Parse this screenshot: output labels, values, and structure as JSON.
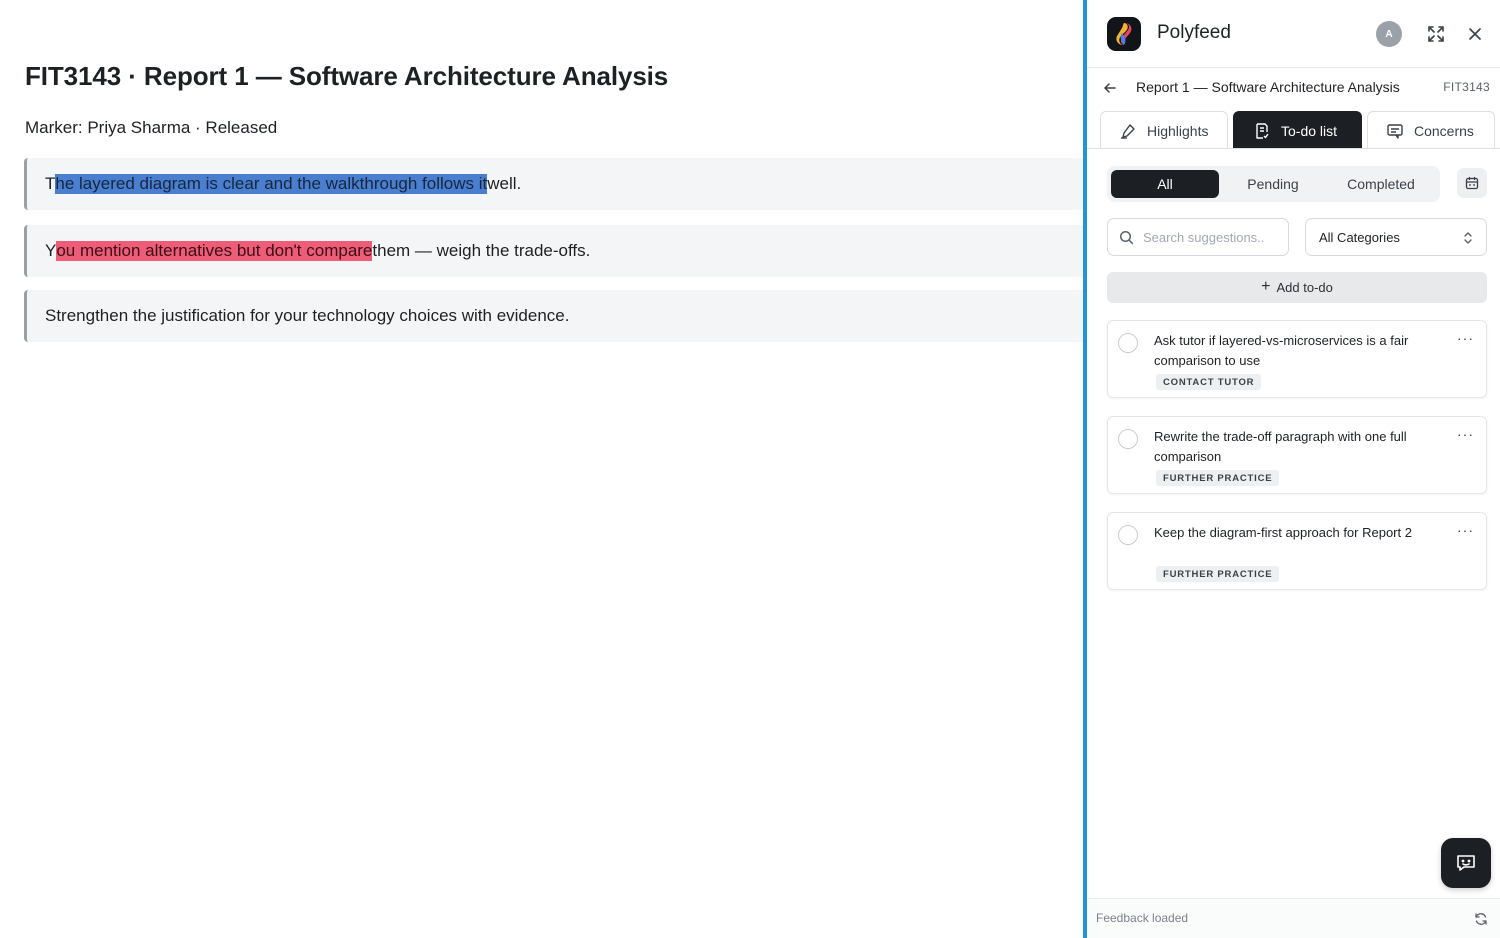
{
  "document": {
    "title": "FIT3143 · Report 1 — Software Architecture Analysis",
    "meta": "Marker: Priya Sharma · Released",
    "feedback": [
      {
        "before": "T",
        "highlight": "he layered diagram is clear and the walkthrough follows it",
        "after": " well.",
        "highlight_color": "#4a7fd0"
      },
      {
        "before": "Y",
        "highlight": "ou mention alternatives but don't compare",
        "after": " them — weigh the trade-offs.",
        "highlight_color": "#ef5c77"
      },
      {
        "text": "Strengthen the justification for your technology choices with evidence."
      }
    ]
  },
  "panel": {
    "brand": "Polyfeed",
    "avatar_initial": "A",
    "accent_color": "#1f94d8",
    "icons": {
      "logo": "polyfeed-logo-icon",
      "expand": "expand-icon",
      "close": "close-icon",
      "back": "back-arrow-icon",
      "highlights": "highlighter-icon",
      "todo": "todo-list-icon",
      "concerns": "concerns-icon",
      "calendar": "calendar-icon",
      "search": "search-icon",
      "select": "chevron-updown-icon",
      "chat": "chat-icon",
      "refresh": "refresh-icon"
    },
    "breadcrumb": {
      "title": "Report 1 — Software Architecture Analysis",
      "code": "FIT3143"
    },
    "tabs": [
      {
        "label": "Highlights",
        "active": false
      },
      {
        "label": "To-do list",
        "active": true
      },
      {
        "label": "Concerns",
        "active": false
      }
    ],
    "filters": [
      {
        "label": "All",
        "active": true
      },
      {
        "label": "Pending",
        "active": false
      },
      {
        "label": "Completed",
        "active": false
      }
    ],
    "search": {
      "placeholder": "Search suggestions..",
      "value": ""
    },
    "category_select": {
      "selected": "All Categories"
    },
    "add_button": {
      "label": "Add to-do"
    },
    "todos": [
      {
        "text": "Ask tutor if layered-vs-microservices is a fair comparison to use",
        "tag": "CONTACT TUTOR",
        "done": false
      },
      {
        "text": "Rewrite the trade-off paragraph with one full comparison",
        "tag": "FURTHER PRACTICE",
        "done": false
      },
      {
        "text": "Keep the diagram-first approach for Report 2",
        "tag": "FURTHER PRACTICE",
        "done": false
      }
    ],
    "more_label": "···",
    "status": "Feedback loaded"
  }
}
